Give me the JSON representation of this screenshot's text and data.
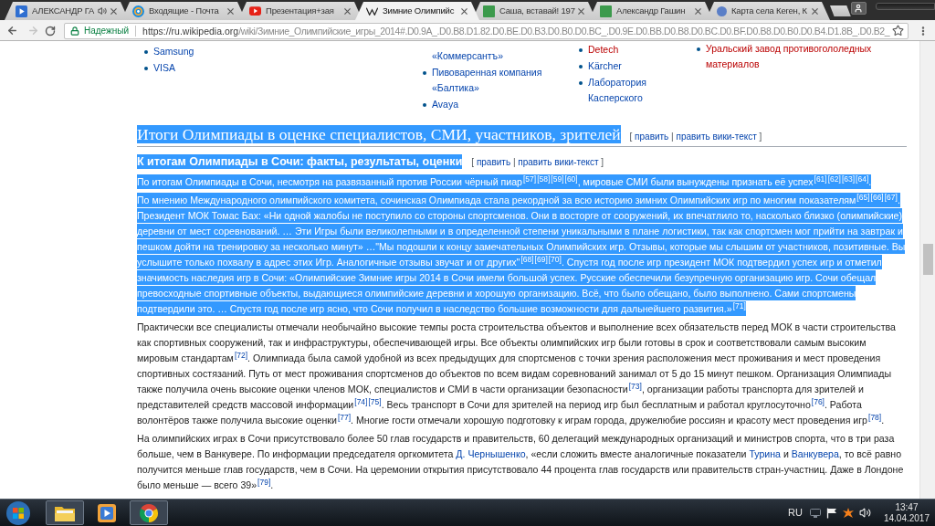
{
  "browser": {
    "tabs": [
      {
        "title": "АЛЕКСАНДР ГА",
        "kind": "play",
        "audio": true,
        "selected": false
      },
      {
        "title": "Входящие - Почта",
        "kind": "mail",
        "audio": false,
        "selected": false
      },
      {
        "title": "Презентация+зая",
        "kind": "video",
        "audio": false,
        "selected": false
      },
      {
        "title": "Зимние Олимпийс",
        "kind": "wiki",
        "audio": false,
        "selected": true
      },
      {
        "title": "Саша, вставай! 197",
        "kind": "sheet",
        "audio": false,
        "selected": false
      },
      {
        "title": "Александр Гашин",
        "kind": "sheet",
        "audio": false,
        "selected": false
      },
      {
        "title": "Карта села Кеген, К",
        "kind": "map",
        "audio": false,
        "selected": false
      }
    ],
    "navigation": {
      "back": {
        "disabled": false
      },
      "forward": {
        "disabled": true
      }
    },
    "address_bar": {
      "security_label": "Надежный",
      "url_host": "https://ru.wikipedia.org",
      "url_path": "/wiki/Зимние_Олимпийские_игры_2014#.D0.9A_.D0.B8.D1.82.D0.BE.D0.B3.D0.B0.D0.BC_.D0.9E.D0.BB.D0.B8.D0.BC.D0.BF.D0.B8.D0.B0.D0.B4.D1.8B_.D0.B2_"
    }
  },
  "article": {
    "sponsor_columns": [
      {
        "items": [
          {
            "text": "Samsung",
            "kind": "link",
            "bullet": true
          },
          {
            "text": "VISA",
            "kind": "link",
            "bullet": true
          }
        ]
      },
      {
        "items": [
          {
            "text": "«Коммерсантъ»",
            "kind": "link",
            "bullet": false
          },
          {
            "text": "Пивоваренная компания «Балтика»",
            "kind": "link",
            "bullet": true
          },
          {
            "text": "Avaya",
            "kind": "link",
            "bullet": true
          }
        ]
      },
      {
        "items": [
          {
            "text": "Detech",
            "kind": "redlink",
            "bullet": true
          },
          {
            "text": "Kärcher",
            "kind": "link",
            "bullet": true
          },
          {
            "text": "Лаборатория Касперского",
            "kind": "link",
            "bullet": true
          }
        ]
      },
      {
        "items": [
          {
            "text": "Уральский завод противогололедных материалов",
            "kind": "redlink",
            "bullet": true
          }
        ]
      }
    ],
    "section": {
      "heading": "Итоги Олимпиады в оценке специалистов, СМИ, участников, зрителей",
      "selected": true,
      "edit_links": {
        "open": "[",
        "links": [
          "править",
          "править вики-текст"
        ],
        "separator": "|",
        "close": "]"
      }
    },
    "subsection": {
      "heading": "К итогам Олимпиады в Сочи: факты, результаты, оценки",
      "selected": true,
      "edit_links": {
        "open": "[",
        "links": [
          "править",
          "править вики-текст"
        ],
        "separator": "|",
        "close": "]"
      }
    },
    "paragraphs": [
      {
        "selected": true,
        "segments": [
          {
            "kind": "text",
            "text": "По итогам Олимпиады в Сочи, несмотря на развязанный против России чёрный пиар"
          },
          {
            "kind": "ref",
            "text": "[57]"
          },
          {
            "kind": "ref",
            "text": "[58]"
          },
          {
            "kind": "ref",
            "text": "[59]"
          },
          {
            "kind": "ref",
            "text": "[60]"
          },
          {
            "kind": "text",
            "text": ", мировые СМИ были вынуждены признать её успех"
          },
          {
            "kind": "ref",
            "text": "[61]"
          },
          {
            "kind": "ref",
            "text": "[62]"
          },
          {
            "kind": "ref",
            "text": "[63]"
          },
          {
            "kind": "ref",
            "text": "[64]"
          },
          {
            "kind": "text",
            "text": "."
          }
        ]
      },
      {
        "selected": true,
        "segments": [
          {
            "kind": "text",
            "text": "По мнению Международного олимпийского комитета, сочинская Олимпиада стала рекордной за всю историю зимних Олимпийских игр по многим показателям"
          },
          {
            "kind": "ref",
            "text": "[65]"
          },
          {
            "kind": "ref",
            "text": "[66]"
          },
          {
            "kind": "ref",
            "text": "[67]"
          },
          {
            "kind": "text",
            "text": ". Президент МОК Томас Бах: «Ни одной жалобы не поступило со стороны спортсменов. Они в восторге от сооружений, их впечатлило то, насколько близко (олимпийские) деревни от мест соревнований. … Эти Игры были великолепными и в определенной степени уникальными в плане логистики, так как спортсмен мог прийти на завтрак и пешком дойти на тренировку за несколько минут» …\"Мы подошли к концу замечательных Олимпийских игр. Отзывы, которые мы слышим от участников, позитивные. Вы услышите только похвалу в адрес этих Игр. Аналогичные отзывы звучат и от других\""
          },
          {
            "kind": "ref",
            "text": "[68]"
          },
          {
            "kind": "ref",
            "text": "[69]"
          },
          {
            "kind": "ref",
            "text": "[70]"
          },
          {
            "kind": "text",
            "text": ". Спустя год после игр президент МОК подтвердил успех игр и отметил значимость наследия игр в Сочи: «Олимпийские Зимние игры 2014 в Сочи имели большой успех. Русские обеспечили безупречную организацию игр. Сочи обещал превосходные спортивные объекты, выдающиеся олимпийские деревни и хорошую организацию. Всё, что было обещано, было выполнено. Сами спортсмены подтвердили это. … Спустя год после игр ясно, что Сочи получил в наследство большие возможности для дальнейшего развития.»"
          },
          {
            "kind": "ref",
            "text": "[71]"
          }
        ]
      },
      {
        "selected": false,
        "segments": [
          {
            "kind": "text",
            "text": "Практически все специалисты отмечали необычайно высокие темпы роста строительства объектов и выполнение всех обязательств перед МОК в части строительства как спортивных сооружений, так и инфраструктуры, обеспечивающей игры. Все объекты олимпийских игр были готовы в срок и соответствовали самым высоким мировым стандартам"
          },
          {
            "kind": "ref",
            "text": "[72]"
          },
          {
            "kind": "text",
            "text": ". Олимпиада была самой удобной из всех предыдущих для спортсменов с точки зрения расположения мест проживания и мест проведения спортивных состязаний. Путь от мест проживания спортсменов до объектов по всем видам соревнований занимал от 5 до 15 минут пешком. Организация Олимпиады также получила очень высокие оценки членов МОК, специалистов и СМИ в части организации безопасности"
          },
          {
            "kind": "ref",
            "text": "[73]"
          },
          {
            "kind": "text",
            "text": ", организации работы транспорта для зрителей и представителей средств массовой информации"
          },
          {
            "kind": "ref",
            "text": "[74]"
          },
          {
            "kind": "ref",
            "text": "[75]"
          },
          {
            "kind": "text",
            "text": ". Весь транспорт в Сочи для зрителей на период игр был бесплатным и работал круглосуточно"
          },
          {
            "kind": "ref",
            "text": "[76]"
          },
          {
            "kind": "text",
            "text": ". Работа волонтёров также получила высокие оценки"
          },
          {
            "kind": "ref",
            "text": "[77]"
          },
          {
            "kind": "text",
            "text": ". Многие гости отмечали хорошую подготовку к играм города, дружелюбие россиян и красоту мест проведения игр"
          },
          {
            "kind": "ref",
            "text": "[78]"
          },
          {
            "kind": "text",
            "text": "."
          }
        ]
      },
      {
        "selected": false,
        "segments": [
          {
            "kind": "text",
            "text": "На олимпийских играх в Сочи присутствовало более 50 глав государств и правительств, 60 делегаций международных организаций и министров спорта, что в три раза больше, чем в Ванкувере. По информации председателя оргкомитета "
          },
          {
            "kind": "link",
            "text": "Д. Чернышенко"
          },
          {
            "kind": "text",
            "text": ", «если сложить вместе аналогичные показатели "
          },
          {
            "kind": "link",
            "text": "Турина"
          },
          {
            "kind": "text",
            "text": " и "
          },
          {
            "kind": "link",
            "text": "Ванкувера"
          },
          {
            "kind": "text",
            "text": ", то всё равно получится меньше глав государств, чем в Сочи. На церемонии открытия присутствовало 44 процента глав государств или правительств стран-участниц. Даже в Лондоне было меньше — всего 39»"
          },
          {
            "kind": "ref",
            "text": "[79]"
          },
          {
            "kind": "text",
            "text": "."
          }
        ]
      }
    ]
  },
  "taskbar": {
    "apps": [
      {
        "kind": "folder",
        "open": true
      },
      {
        "kind": "media",
        "open": false
      },
      {
        "kind": "browser",
        "open": true
      }
    ],
    "language": "RU",
    "time": "13:47",
    "date": "14.04.2017"
  }
}
